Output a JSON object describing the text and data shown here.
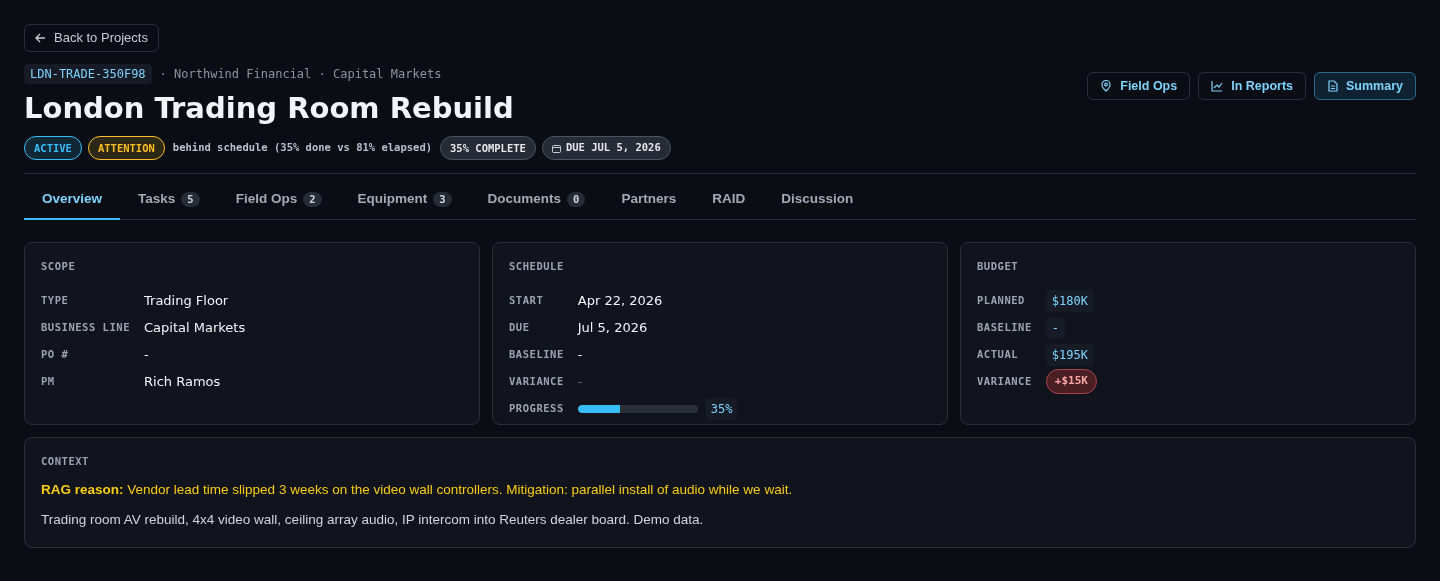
{
  "back_link": "Back to Projects",
  "header": {
    "code": "LDN-TRADE-350F98",
    "meta": "· Northwind Financial · Capital Markets",
    "title": "London Trading Room Rebuild",
    "actions": [
      {
        "label": "Field Ops",
        "selected": false
      },
      {
        "label": "In Reports",
        "selected": false
      },
      {
        "label": "Summary",
        "selected": true
      }
    ],
    "badges": [
      {
        "kind": "status",
        "label": "ACTIVE",
        "color": "#38bdf8"
      },
      {
        "kind": "status",
        "label": "ATTENTION",
        "color": "#fbbf24"
      },
      {
        "kind": "note",
        "label": "behind schedule (35% done vs 81% elapsed)"
      },
      {
        "kind": "pill",
        "label": "35% COMPLETE"
      },
      {
        "kind": "date",
        "label": "DUE JUL 5, 2026"
      }
    ]
  },
  "tabs": [
    {
      "label": "Overview",
      "selected": true
    },
    {
      "label": "Tasks",
      "count": "5",
      "selected": false
    },
    {
      "label": "Field Ops",
      "count": "2",
      "selected": false
    },
    {
      "label": "Equipment",
      "count": "3",
      "selected": false
    },
    {
      "label": "Documents",
      "count": "0",
      "selected": false
    },
    {
      "label": "Partners",
      "selected": false
    },
    {
      "label": "RAID",
      "selected": false
    },
    {
      "label": "Discussion",
      "selected": false
    }
  ],
  "cards": [
    {
      "title": "SCOPE",
      "rows": [
        {
          "kind": "text",
          "label": "TYPE",
          "value": "Trading Floor"
        },
        {
          "kind": "text",
          "label": "BUSINESS LINE",
          "value": "Capital Markets"
        },
        {
          "kind": "text",
          "label": "PO #",
          "value": "-"
        },
        {
          "kind": "text",
          "label": "PM",
          "value": "Rich Ramos"
        }
      ]
    },
    {
      "title": "SCHEDULE",
      "rows": [
        {
          "kind": "text",
          "label": "START",
          "value": "Apr 22, 2026"
        },
        {
          "kind": "text",
          "label": "DUE",
          "value": "Jul 5, 2026"
        },
        {
          "kind": "text",
          "label": "BASELINE",
          "value": "-"
        },
        {
          "kind": "muted",
          "label": "VARIANCE",
          "value": "-"
        },
        {
          "kind": "progress",
          "label": "PROGRESS",
          "level": 0.35,
          "value": "35%"
        }
      ]
    },
    {
      "title": "BUDGET",
      "rows": [
        {
          "kind": "chip",
          "label": "PLANNED",
          "value": "$180K"
        },
        {
          "kind": "chip",
          "label": "BASELINE",
          "value": "-"
        },
        {
          "kind": "chip",
          "label": "ACTUAL",
          "value": "$195K"
        },
        {
          "kind": "danger",
          "label": "VARIANCE",
          "value": "+$15K"
        }
      ]
    }
  ],
  "context": {
    "title": "CONTEXT",
    "rag": "**RAG reason:** Vendor lead time slipped 3 weeks on the video wall controllers. Mitigation: parallel install of audio while we wait.",
    "description": "Trading room AV rebuild, 4x4 video wall, ceiling array audio, IP intercom into Reuters dealer board. Demo data."
  }
}
